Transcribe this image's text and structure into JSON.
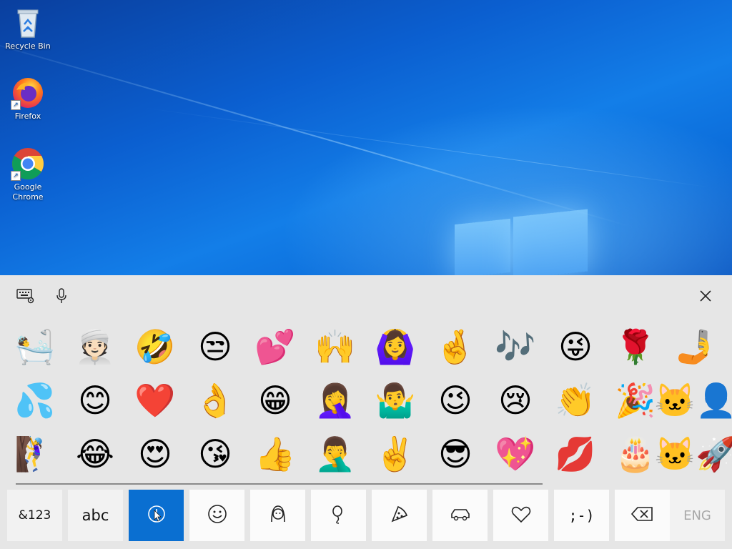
{
  "desktop": {
    "icons": [
      {
        "label": "Recycle Bin",
        "icon": "recycle-bin-icon"
      },
      {
        "label": "Firefox",
        "icon": "firefox-icon"
      },
      {
        "label": "Google Chrome",
        "icon": "chrome-icon"
      }
    ]
  },
  "keyboard": {
    "toolbar": {
      "settings_icon": "keyboard-settings-icon",
      "mic_icon": "microphone-icon",
      "close_icon": "close-icon"
    },
    "emoji_rows": [
      [
        "🛀",
        "👳🏻",
        "🤣",
        "😒",
        "💕",
        "🙌",
        "🙆‍♀️",
        "🤞",
        "🎶",
        "😜",
        "🌹",
        "🤳"
      ],
      [
        "💦",
        "😊",
        "❤️",
        "👌",
        "😁",
        "🤦‍♀️",
        "🤷‍♂️",
        "😉",
        "😢",
        "👏",
        "🎉",
        "🐱‍👤"
      ],
      [
        "🧗‍♀️",
        "😂",
        "😍",
        "😘",
        "👍",
        "🤦‍♂️",
        "✌️",
        "😎",
        "💖",
        "💋",
        "🎂",
        "🐱‍🚀"
      ]
    ],
    "bottom_keys": {
      "symbols": "&123",
      "abc": "abc",
      "recent_icon": "recent-history-icon",
      "smileys_icon": "smiley-icon",
      "people_icon": "person-icon",
      "celebration_icon": "balloon-icon",
      "food_icon": "pizza-icon",
      "travel_icon": "car-icon",
      "heart_icon": "heart-icon",
      "emoticon": ";-)",
      "backspace_icon": "backspace-icon",
      "language": "ENG"
    },
    "colors": {
      "selected": "#0a6fd1",
      "background": "#e6e6e6",
      "key": "#fbfbfb"
    }
  }
}
